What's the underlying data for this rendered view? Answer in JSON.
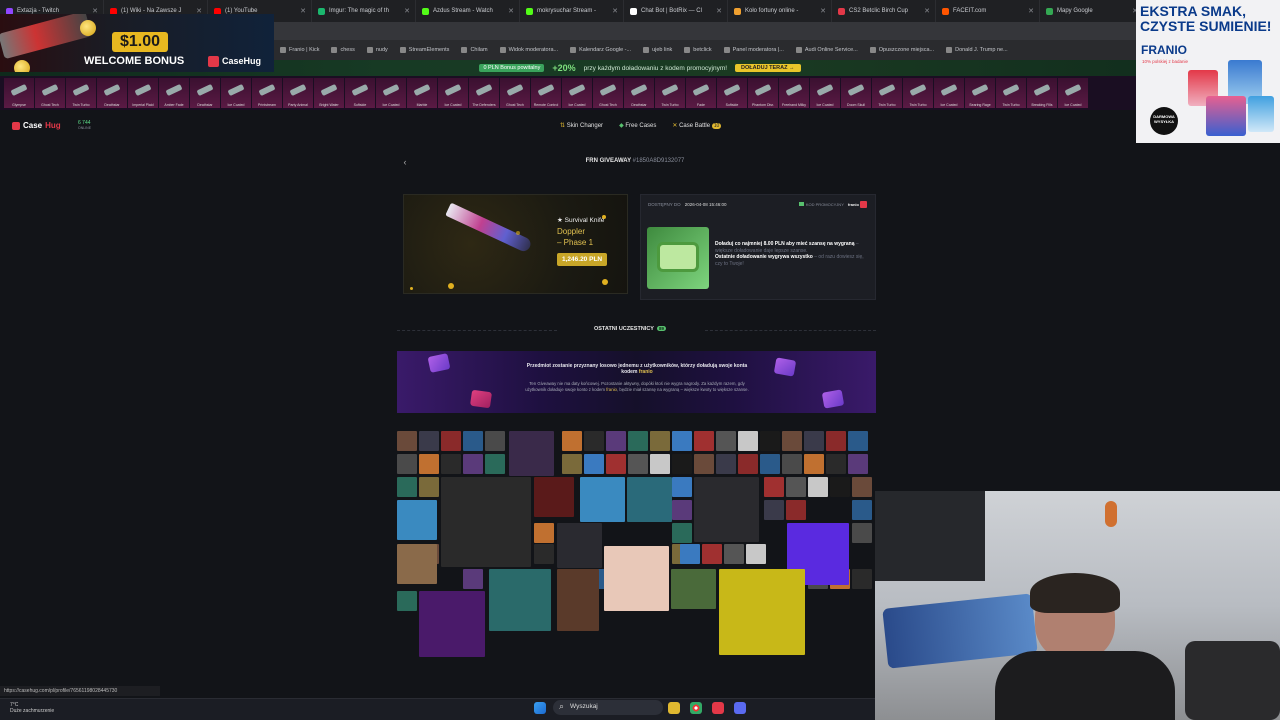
{
  "browser": {
    "tabs": [
      {
        "title": "Extazja - Twitch",
        "color": "#9146ff"
      },
      {
        "title": "(1) Wiki - Na Zawsze J",
        "color": "#ff0000"
      },
      {
        "title": "(1) YouTube",
        "color": "#ff0000"
      },
      {
        "title": "Imgur: The magic of th",
        "color": "#1bb76e"
      },
      {
        "title": "Azdus Stream - Watch",
        "color": "#53fc18"
      },
      {
        "title": "mokrysuchar Stream -",
        "color": "#53fc18"
      },
      {
        "title": "Chat Bot | BotRix — Cl",
        "color": "#ffffff"
      },
      {
        "title": "Koło fortuny online -",
        "color": "#f0a030"
      },
      {
        "title": "CS2 Betclic Birch Cup",
        "color": "#e33848"
      },
      {
        "title": "FACEIT.com",
        "color": "#ff5500"
      },
      {
        "title": "Mapy Google",
        "color": "#34a853"
      },
      {
        "title": "Giveaway – Dołącz",
        "color": "#e33848"
      }
    ],
    "bookmarks": [
      "Franio | Kick",
      "chess",
      "nudy",
      "StreamElements",
      "Chilam",
      "Widok moderatora...",
      "Kalendarz Google -...",
      "ujeb link",
      "betclick",
      "Panel moderatora |...",
      "Audi Online Service...",
      "Opuszczone miejsca...",
      "Donald J. Trump ne..."
    ],
    "status_url": "https://casehug.com/pl/profile/76561198028445730"
  },
  "promo_bar": {
    "tag": "0 PLN Bonus powitalny",
    "big": "+20%",
    "text": "przy każdym doładowaniu z kodem promocyjnym!",
    "button": "DOŁADUJ TERAZ →"
  },
  "live_drops": [
    "Glympse",
    "Ghost Tech",
    "Twin Turbo",
    "Deathstar",
    "Imperial Plaid",
    "Amber Fade",
    "Deathstar",
    "Ice Coated",
    "Printstream",
    "Party Animal",
    "Bright Water",
    "Softside",
    "Ice Coated",
    "Marble",
    "Ice Coated",
    "The Defenders",
    "Ghost Tech",
    "Remote Control",
    "Ice Coated",
    "Ghost Tech",
    "Deathstar",
    "Twin Turbo",
    "Fade",
    "Softside",
    "Phantom Disr.",
    "Freehand Milky",
    "Ice Coated",
    "Doom Skull",
    "Twin Turbo",
    "Twin Turbo",
    "Ice Coated",
    "Searing Rage",
    "Twin Turbo",
    "Breaking Fills",
    "Ice Coated"
  ],
  "site_nav": {
    "logo": "Case",
    "logo_accent": "Hug",
    "online_count": "6 744",
    "online_label": "ONLINE",
    "links": [
      "Skin Changer",
      "Free Cases",
      "Case Battle"
    ],
    "battle_badge": "10"
  },
  "giveaway": {
    "title": "FRN GIVEAWAY",
    "id": "#1850A8D9132077",
    "prize_line1": "★ Survival Knife",
    "prize_line2": "Doppler",
    "prize_line3": "– Phase 1",
    "price": "1,246.20 PLN",
    "available_label": "DOSTĘPNY DO",
    "available_value": "2026-04-08 15:46:00",
    "promo_label": "KOD PROMOCYJNY",
    "promo_code": "franio",
    "info_bold": "Doładuj co najmniej 8.00 PLN aby mieć szansę na wygraną",
    "info_dim": " – większe doładowanie daje lepsze szanse.",
    "info_bold2": "Ostatnie doładowanie wygrywa wszystko",
    "info_dim2": " – od razu dowiesz się, czy to Twoje!"
  },
  "participants": {
    "title": "OSTATNI UCZESTNICY",
    "count": "89",
    "banner_line1": "Przedmiot zostanie przyznany losowo jednemu z użytkowników, którzy doładują swoje konta kodem",
    "banner_code": "franio",
    "banner_line2": "Ten Giveaway nie ma daty końcowej. Pozostanie aktywny, dopóki ktoś nie wygra nagrody. Za każdym razem, gdy użytkownik doładuje swoje konto z kodem",
    "banner_code2": "franio",
    "banner_line3": ", będzie miał szansę na wygraną – większe kwoty to większe szanse."
  },
  "ad_left": {
    "amount": "$1.00",
    "text": "WELCOME BONUS",
    "brand": "CaseHug"
  },
  "ad_right": {
    "headline": "EKSTRA SMAK, CZYSTE SUMIENIE!",
    "brand": "FRANIO",
    "sub": "10% polskiej z badanie",
    "badge": "DARMOWA WYSYŁKA"
  },
  "taskbar": {
    "search": "Wyszukaj",
    "temp": "7°C",
    "weather": "Duże zachmurzenie"
  }
}
